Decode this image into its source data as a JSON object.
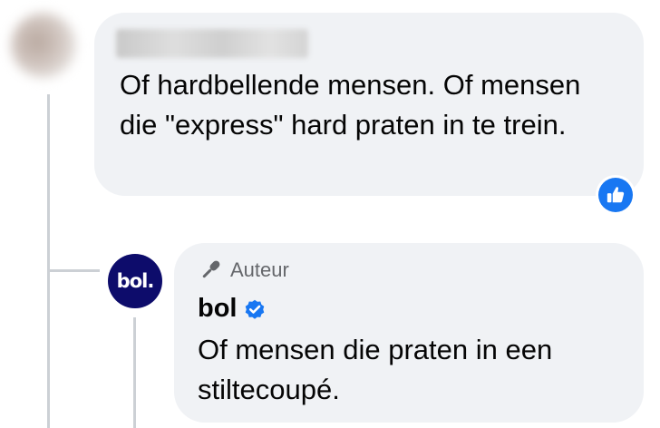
{
  "comment": {
    "text": "Of hardbellende mensen. Of mensen die \"express\" hard praten in te trein."
  },
  "reply": {
    "avatar_text": "bol.",
    "badge_label": "Auteur",
    "author_name": "bol",
    "text": "Of mensen die praten in een stiltecoupé."
  },
  "colors": {
    "bubble": "#f0f2f5",
    "like_blue": "#1877f2",
    "verified_blue": "#1877f2",
    "bol_navy": "#0d0c6b",
    "thread_line": "#ccd0d5"
  },
  "icons": {
    "like": "thumbs-up-icon",
    "author_badge": "microphone-icon",
    "verified": "verified-check-icon"
  }
}
